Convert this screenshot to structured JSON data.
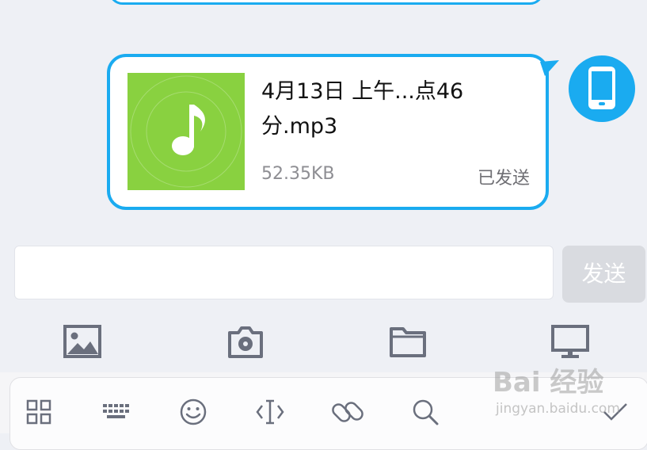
{
  "message": {
    "file_name_line1": "4月13日 上午...点46",
    "file_name_line2": "分.mp3",
    "file_size": "52.35KB",
    "status": "已发送"
  },
  "composer": {
    "input_placeholder": "",
    "send_label": "发送"
  },
  "toolbar": {
    "items": [
      "image-icon",
      "camera-icon",
      "folder-icon",
      "monitor-icon"
    ]
  },
  "keyboard_bar": {
    "items": [
      "grid-icon",
      "keyboard-icon",
      "emoji-icon",
      "cursor-icon",
      "link-icon",
      "search-icon",
      "check-icon"
    ]
  },
  "watermark": {
    "brand": "Bai 经验",
    "url": "jingyan.baidu.com"
  },
  "colors": {
    "accent": "#1aabf0",
    "music_green": "#89d140",
    "send_disabled": "#d9dbe0",
    "icon_gray": "#6a6f7d"
  }
}
